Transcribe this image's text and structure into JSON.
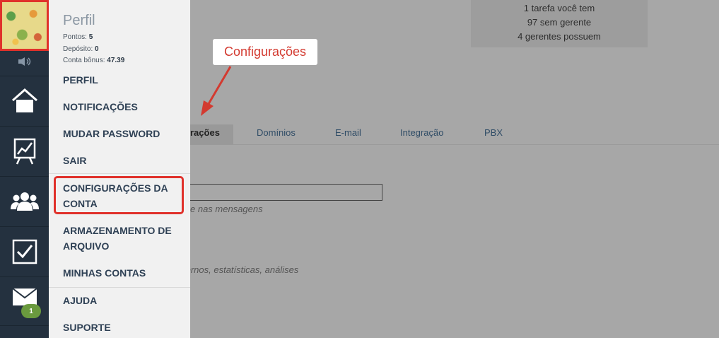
{
  "profile": {
    "title": "Perfil",
    "stats": [
      {
        "label": "Pontos:",
        "value": "5"
      },
      {
        "label": "Depósito:",
        "value": "0"
      },
      {
        "label": "Conta bônus:",
        "value": "47.39"
      }
    ],
    "menu": [
      "PERFIL",
      "NOTIFICAÇÕES",
      "MUDAR PASSWORD",
      "SAIR",
      "CONFIGURAÇÕES DA CONTA",
      "ARMAZENAMENTO DE ARQUIVO",
      "MINHAS CONTAS",
      "AJUDA",
      "SUPORTE"
    ]
  },
  "rail": {
    "icons": [
      "volume-icon",
      "home-icon",
      "chart-icon",
      "users-icon",
      "tasks-icon",
      "mail-icon"
    ],
    "mail_badge": "1"
  },
  "notifications": {
    "lines": [
      "1 tarefa você tem",
      "97 sem gerente",
      "4 gerentes possuem"
    ]
  },
  "tabs": [
    "rações",
    "Domínios",
    "E-mail",
    "Integração",
    "PBX"
  ],
  "hints": {
    "field_hint": "e nas mensagens",
    "section_hint": "ternos, estatísticas, análises"
  },
  "callout": {
    "text": "Configurações"
  },
  "colors": {
    "rail_bg": "#24313f",
    "highlight": "#e0312b",
    "menu_text": "#2f4155",
    "badge": "#6a9a3e"
  }
}
